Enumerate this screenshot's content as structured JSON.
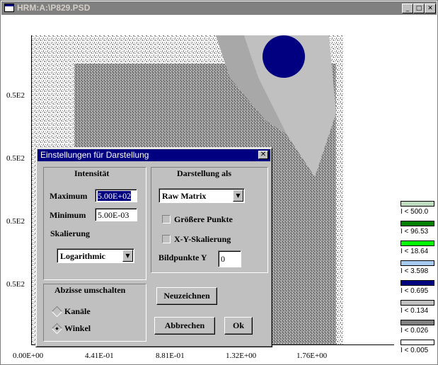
{
  "window": {
    "title": "HRM:A:\\P829.PSD"
  },
  "chart_data": {
    "type": "heatmap",
    "x_ticks": [
      "0.00E+00",
      "4.41E-01",
      "8.81E-01",
      "1.32E+00",
      "1.76E+00"
    ],
    "y_ticks": [
      "0.5E2",
      "0.5E2",
      "0.5E2",
      "0.5E2"
    ],
    "legend": [
      {
        "label": "I < 500.0",
        "color": "#c0dcc0"
      },
      {
        "label": "I < 96.53",
        "color": "#008000"
      },
      {
        "label": "I < 18.64",
        "color": "#00ff00"
      },
      {
        "label": "I < 3.598",
        "color": "#a6caf0"
      },
      {
        "label": "I < 0.695",
        "color": "#000080"
      },
      {
        "label": "I < 0.134",
        "color": "#c0c0c0"
      },
      {
        "label": "I < 0.026",
        "color": "#808080"
      },
      {
        "label": "I < 0.005",
        "color": "#ffffff"
      }
    ]
  },
  "dialog": {
    "title": "Einstellungen für Darstellung",
    "intensitaet": {
      "heading": "Intensität",
      "maximum_label": "Maximum",
      "maximum_value": "5.00E+02",
      "minimum_label": "Minimum",
      "minimum_value": "5.00E-03",
      "skalierung_label": "Skalierung",
      "skalierung_value": "Logarithmic"
    },
    "darstellung": {
      "heading": "Darstellung als",
      "mode_value": "Raw Matrix",
      "groessere_punkte": "Größere Punkte",
      "xy_skalierung": "X-Y-Skalierung",
      "bildpunkte_label": "Bildpunkte Y",
      "bildpunkte_value": "0"
    },
    "abzisse": {
      "heading": "Abzisse umschalten",
      "kanaele": "Kanäle",
      "winkel": "Winkel"
    },
    "buttons": {
      "neuzeichnen": "Neuzeichnen",
      "abbrechen": "Abbrechen",
      "ok": "Ok"
    }
  }
}
